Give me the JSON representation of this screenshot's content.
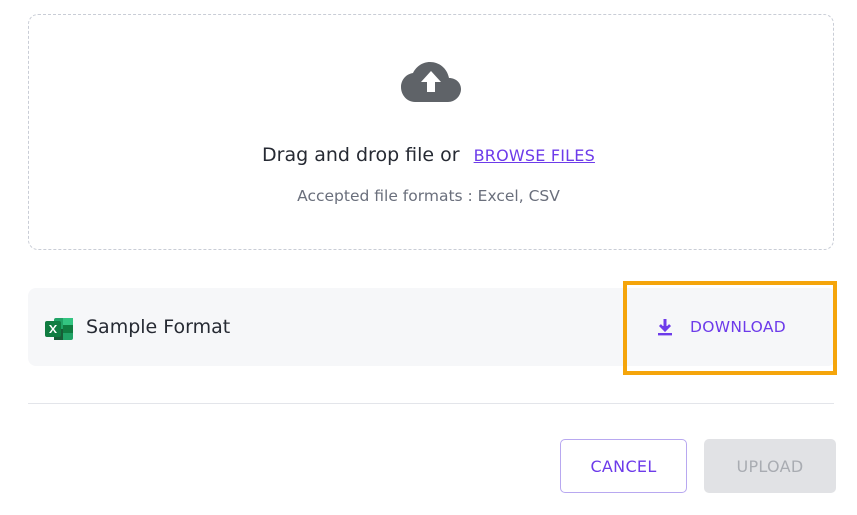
{
  "dropzone": {
    "icon": "cloud-upload-icon",
    "drag_text": "Drag and drop file or",
    "browse_label": "BROWSE FILES",
    "formats_text": "Accepted file formats : Excel, CSV"
  },
  "sample": {
    "icon": "excel-icon",
    "label": "Sample Format",
    "download_icon": "download-icon",
    "download_label": "DOWNLOAD"
  },
  "actions": {
    "cancel_label": "CANCEL",
    "upload_label": "UPLOAD",
    "upload_disabled": true
  },
  "colors": {
    "accent": "#6d3bea",
    "highlight": "#f5a50b",
    "excel_green": "#1e7a45"
  }
}
